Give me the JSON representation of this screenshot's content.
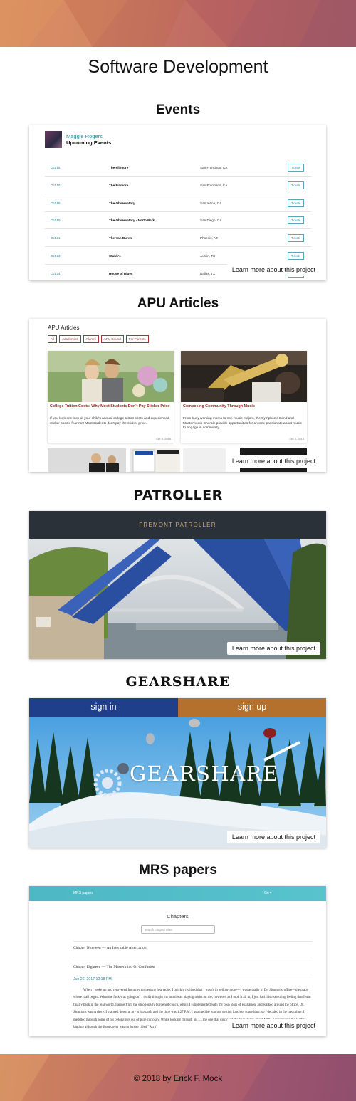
{
  "page": {
    "title": "Software Development",
    "copyright": "© 2018 by Erick F. Mock"
  },
  "learn_more_label": "Learn more about this project",
  "events": {
    "section_title": "Events",
    "artist": "Maggie Rogers",
    "subtitle": "Upcoming Events",
    "rows": [
      {
        "date": "Oct 15",
        "venue": "The Fillmore",
        "city": "San Francisco, CA",
        "tickets": "Tickets"
      },
      {
        "date": "Oct 16",
        "venue": "The Fillmore",
        "city": "San Francisco, CA",
        "tickets": "Tickets"
      },
      {
        "date": "Oct 18",
        "venue": "The Observatory",
        "city": "Santa Ana, CA",
        "tickets": "Tickets"
      },
      {
        "date": "Oct 19",
        "venue": "The Observatory - North Park",
        "city": "San Diego, CA",
        "tickets": "Tickets"
      },
      {
        "date": "Oct 21",
        "venue": "The Van Buren",
        "city": "Phoenix, AZ",
        "tickets": "Tickets"
      },
      {
        "date": "Oct 23",
        "venue": "Stubb's",
        "city": "Austin, TX",
        "tickets": "Tickets"
      },
      {
        "date": "Oct 24",
        "venue": "House of Blues",
        "city": "Dallas, TX",
        "tickets": "Tickets"
      }
    ]
  },
  "apu": {
    "section_title": "APU Articles",
    "label": "APU Articles",
    "filters": [
      "All",
      "Academics",
      "Alumni",
      "APU Bound",
      "For Parents"
    ],
    "articles": [
      {
        "title": "College Tuition Costs: Why Most Students Don't Pay Sticker Price",
        "excerpt": "If you look one look at your child's annual college tuition costs and experienced sticker shock, fear not! Most students don't pay the sticker price.",
        "date": "Oct 9, 2018"
      },
      {
        "title": "Composing Community Through Music",
        "excerpt": "From busy working moms to non-music majors, the Symphonic Band and Masterworks Chorale provide opportunities for anyone passionate about music to engage in community.",
        "date": "Oct 4, 2018"
      }
    ]
  },
  "patroller": {
    "section_title": "PATROLLER",
    "header": "FREMONT PATROLLER"
  },
  "gearshare": {
    "section_title": "GEARSHARE",
    "sign_in": "sign in",
    "sign_up": "sign up",
    "logo_text": "GEARSHARE"
  },
  "mrs": {
    "section_title": "MRS papers",
    "brand": "MRS papers",
    "go_label": "Go ▾",
    "heading": "Chapters",
    "search_placeholder": "search chapter titles",
    "chapters": [
      "Chapter Nineteen — An Inevitable Altercation",
      "Chapter Eighteen — The Mastermind Of Confusion"
    ],
    "date": "Jun 26, 2017 12:18 PM",
    "body": "When I woke up and recovered from my tormenting heartache, I quickly realized that I wasn't in hell anymore—I was actually in Dr. Simmons' office—the place where it all began. What the fuck was going on? I really thought my mind was playing tricks on me; however, as I took it all in, I just had this reassuring feeling that I was finally back in the real world. I arose from the emotionally burdened couch, which I supplemented with my own tears of exaltation, and walked around the office. Dr. Simmons wasn't there. I glanced down at my wristwatch and the time was 1:27 P.M. I assumed he was out getting lunch or something, so I decided in the meantime, I meddled through some of his belongings out of pure curiosity. While looking through his f... the one that disclosed the knowledge about MRS, I recognized the leather binding although the front cover was no longer titled \"Acro\""
  },
  "colors": {
    "teal": "#2a8aa0",
    "apu_red": "#a33333",
    "patroller_bar": "#2b3138",
    "gs_blue": "#1f3f8a",
    "gs_orange": "#b4702d"
  }
}
